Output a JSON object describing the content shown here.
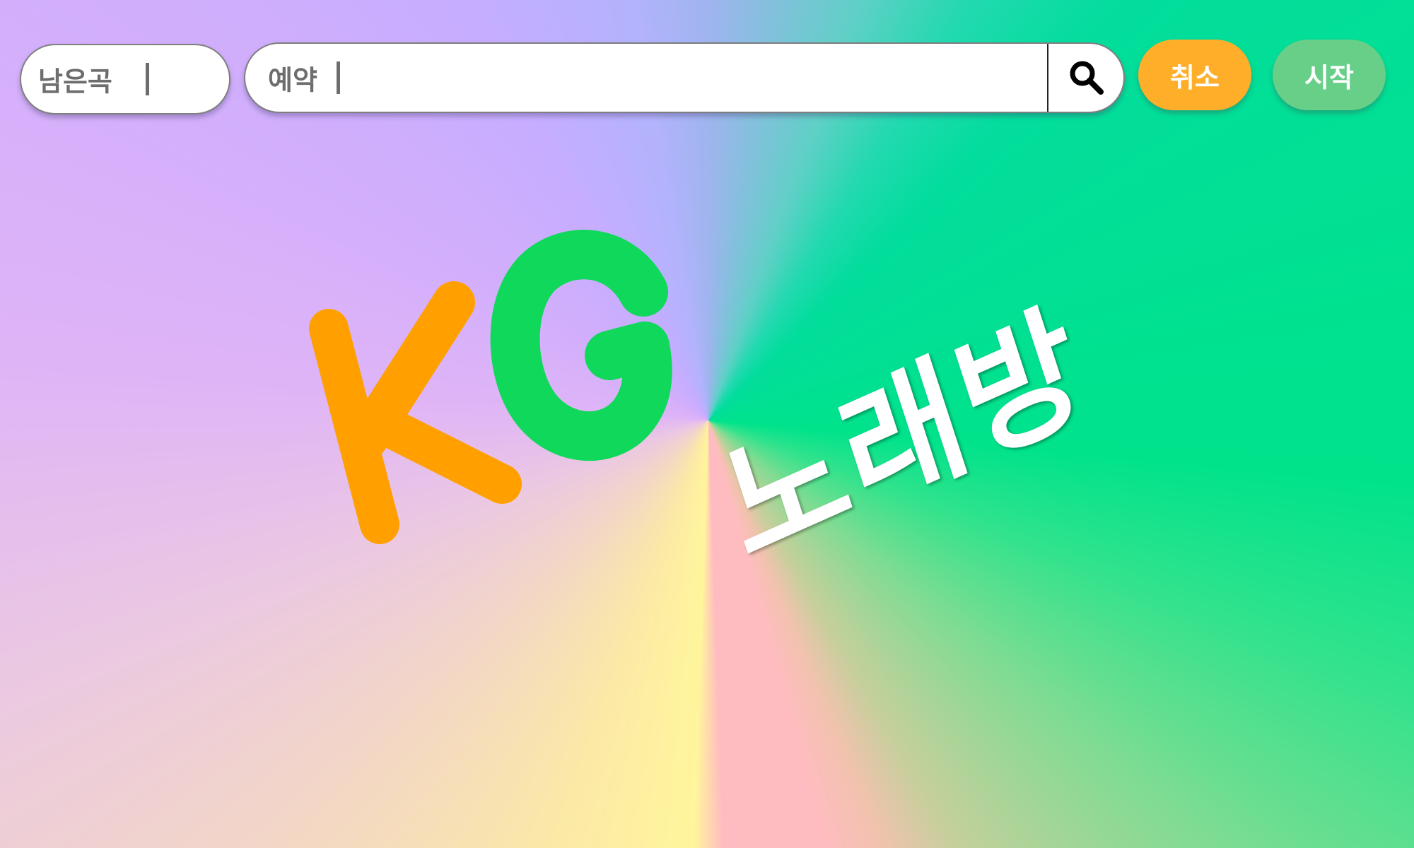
{
  "toolbar": {
    "remaining": {
      "label": "남은곡"
    },
    "search": {
      "label": "예약",
      "value": "",
      "icon": "search-icon"
    },
    "cancel_label": "취소",
    "start_label": "시작"
  },
  "brand": {
    "logo_text": "KG",
    "tagline": "노래방"
  },
  "colors": {
    "logo_k": "#ffa000",
    "logo_g": "#10d85a",
    "cancel_button": "#ffae2a",
    "start_button": "#68cf88",
    "background_green": "#00e38b",
    "background_purple": "#d1aefc",
    "background_yellow": "#fff59c",
    "background_pink": "#ffbcc0"
  }
}
